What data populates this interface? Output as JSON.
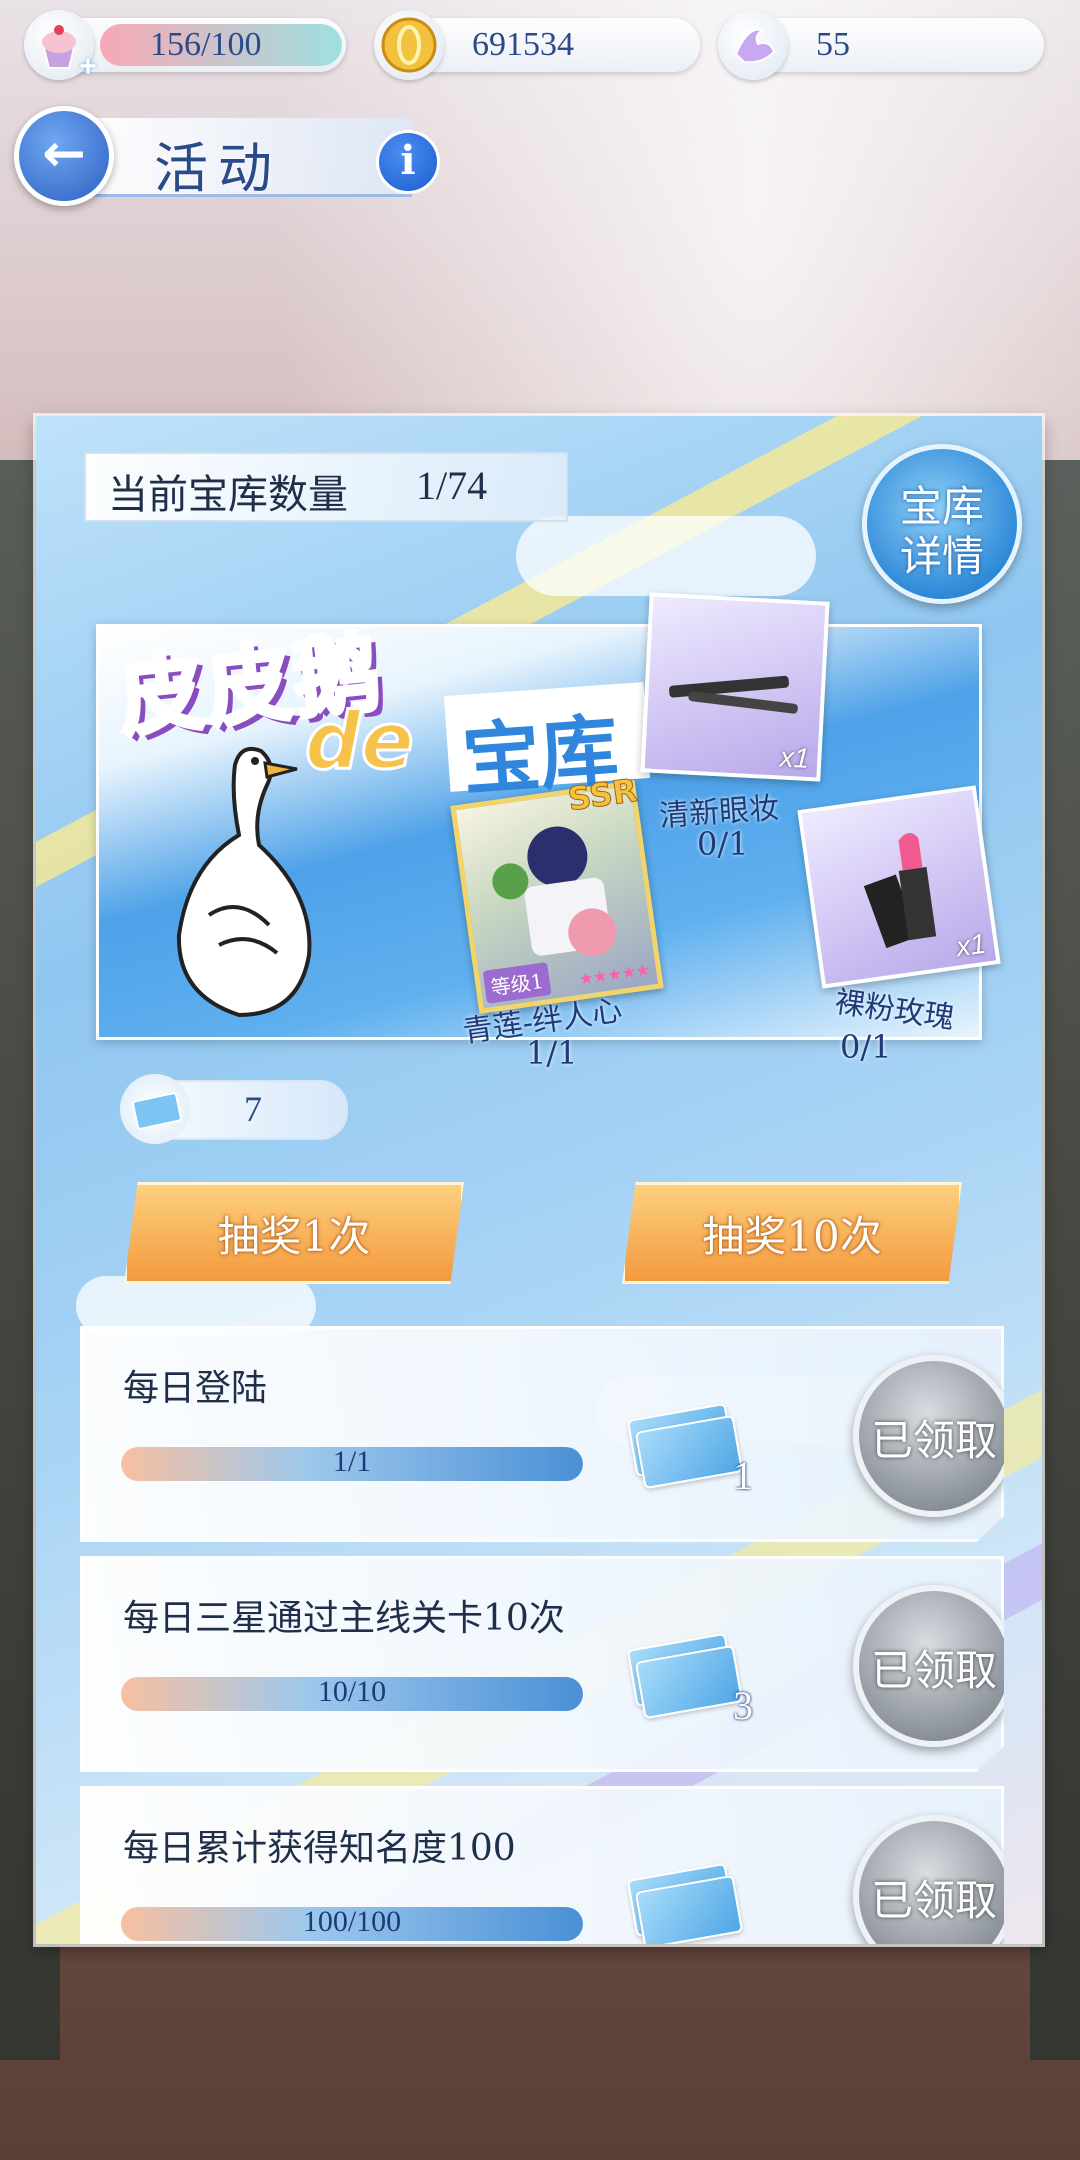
{
  "top_bar": {
    "stamina": {
      "value": "156/100",
      "icon": "cupcake-icon"
    },
    "coins": {
      "value": "691534",
      "icon": "gold-coin-icon"
    },
    "gems": {
      "value": "55",
      "icon": "crystal-swan-icon"
    }
  },
  "header": {
    "title": "活动"
  },
  "panel": {
    "vault_count_label": "当前宝库数量",
    "vault_count_value": "1/74",
    "vault_details_line1": "宝库",
    "vault_details_line2": "详情",
    "banner": {
      "title_part1": "皮皮鹅",
      "title_de": "de",
      "title_part2": "宝库"
    },
    "prizes": [
      {
        "name": "青莲-绊人心",
        "progress": "1/1",
        "badge": "SSR",
        "level": "等级1"
      },
      {
        "name": "清新眼妆",
        "progress": "0/1",
        "count": "x1"
      },
      {
        "name": "裸粉玫瑰",
        "progress": "0/1",
        "count": "x1"
      }
    ],
    "tickets": "7",
    "draw_once": "抽奖1次",
    "draw_ten": "抽奖10次"
  },
  "tasks": [
    {
      "name": "每日登陆",
      "progress": "1/1",
      "fill": 1.0,
      "reward_count": "1",
      "status": "已领取"
    },
    {
      "name": "每日三星通过主线关卡10次",
      "progress": "10/10",
      "fill": 1.0,
      "reward_count": "3",
      "status": "已领取"
    },
    {
      "name": "每日累计获得知名度100",
      "progress": "100/100",
      "fill": 1.0,
      "reward_count": "",
      "status": "已领取"
    }
  ]
}
